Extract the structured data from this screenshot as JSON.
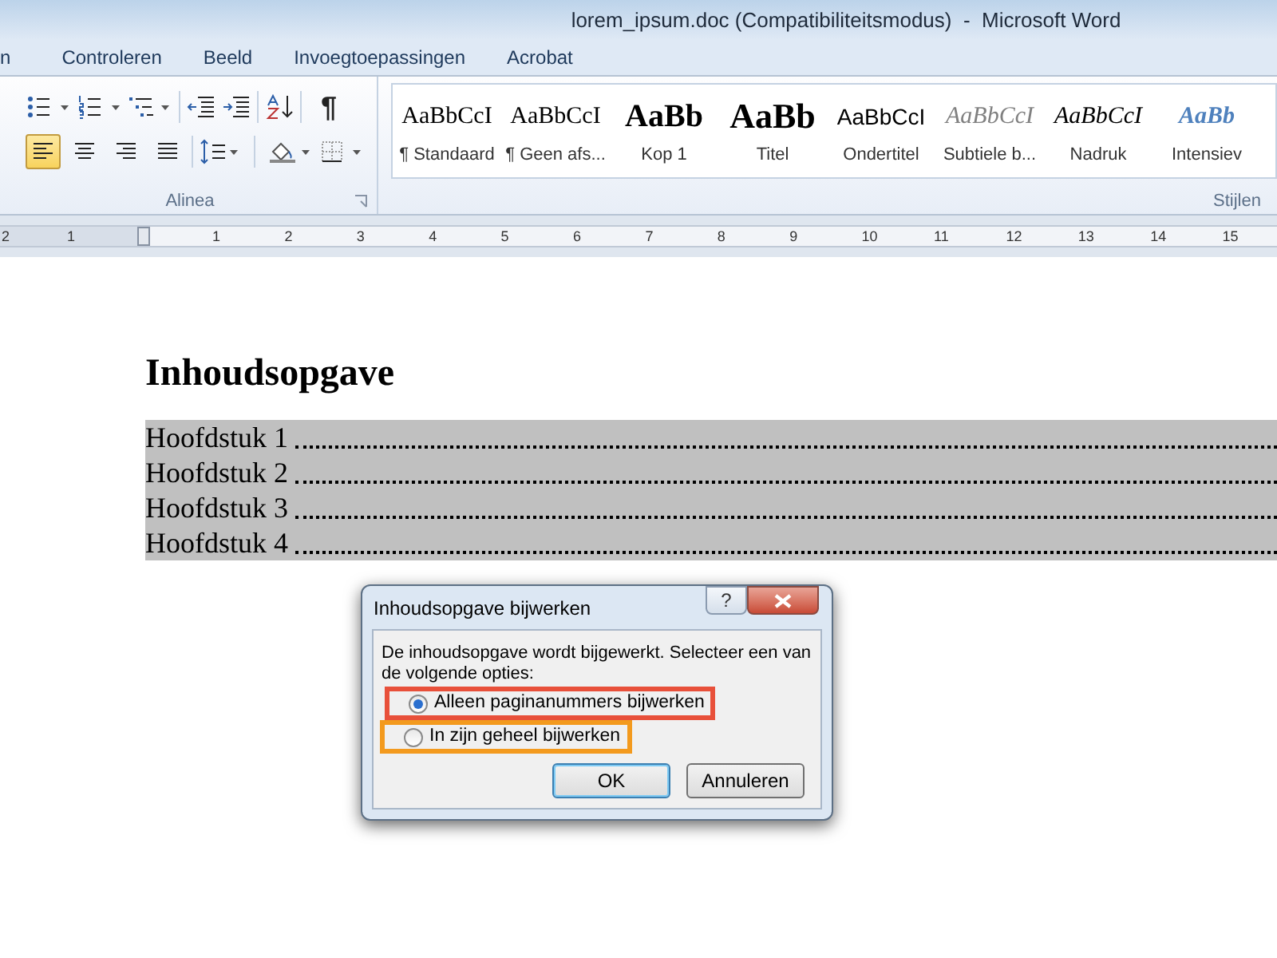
{
  "window": {
    "title": "lorem_ipsum.doc (Compatibiliteitsmodus)  -  Microsoft Word"
  },
  "tabs": [
    {
      "label": "n",
      "selected": false
    },
    {
      "label": "Controleren",
      "selected": false
    },
    {
      "label": "Beeld",
      "selected": false
    },
    {
      "label": "Invoegtoepassingen",
      "selected": false
    },
    {
      "label": "Acrobat",
      "selected": false
    }
  ],
  "paragraph_group": {
    "label": "Alinea",
    "alignments": [
      {
        "kind": "left",
        "selected": true
      },
      {
        "kind": "center",
        "selected": false
      },
      {
        "kind": "right",
        "selected": false
      },
      {
        "kind": "justify",
        "selected": false
      }
    ],
    "pilcrow": "¶"
  },
  "styles_group": {
    "label": "Stijlen",
    "styles": [
      {
        "sample": "AaBbCcI",
        "label": "¶ Standaard",
        "kind": "normal"
      },
      {
        "sample": "AaBbCcI",
        "label": "¶ Geen afs...",
        "kind": "normal"
      },
      {
        "sample": "AaBb",
        "label": "Kop 1",
        "kind": "heading"
      },
      {
        "sample": "AaBb",
        "label": "Titel",
        "kind": "title"
      },
      {
        "sample": "AaBbCcI",
        "label": "Ondertitel",
        "kind": "subtitle"
      },
      {
        "sample": "AaBbCcI",
        "label": "Subtiele b...",
        "kind": "subtle"
      },
      {
        "sample": "AaBbCcI",
        "label": "Nadruk",
        "kind": "emphasis"
      },
      {
        "sample": "AaBb",
        "label": "Intensiev",
        "kind": "intense"
      }
    ]
  },
  "ruler": {
    "left_labels": [
      "2",
      "1"
    ],
    "labels": [
      "1",
      "2",
      "3",
      "4",
      "5",
      "6",
      "7",
      "8",
      "9",
      "10",
      "11",
      "12",
      "13",
      "14",
      "15"
    ]
  },
  "document": {
    "heading": "Inhoudsopgave",
    "toc_entries": [
      "Hoofdstuk 1",
      "Hoofdstuk 2",
      "Hoofdstuk 3",
      "Hoofdstuk 4"
    ]
  },
  "dialog": {
    "title": "Inhoudsopgave bijwerken",
    "help": "?",
    "message": "De inhoudsopgave wordt bijgewerkt. Selecteer een van de volgende opties:",
    "options": [
      {
        "label": "Alleen paginanummers bijwerken",
        "selected": true,
        "color": "#e8503a"
      },
      {
        "label": "In zijn geheel bijwerken",
        "selected": false,
        "color": "#f39a1e"
      }
    ],
    "buttons": [
      {
        "label": "OK",
        "kind": "default"
      },
      {
        "label": "Annuleren",
        "kind": "normal"
      }
    ]
  }
}
